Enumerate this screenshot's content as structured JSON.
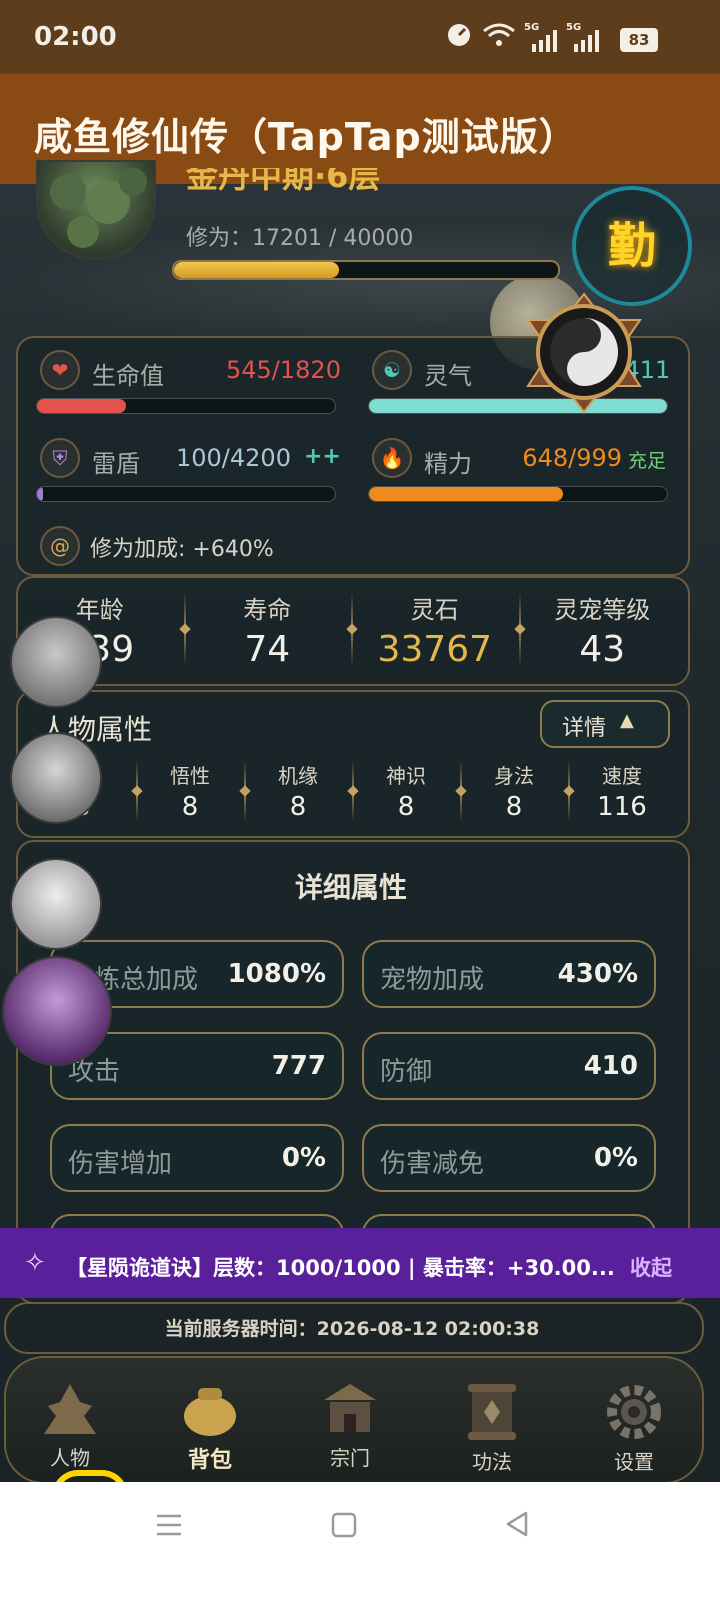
{
  "status_bar": {
    "time": "02:00",
    "battery": "83",
    "net1": "5G",
    "net2": "5G"
  },
  "app_title": "咸鱼修仙传（TapTap测试版）",
  "profile": {
    "realm": "金丹中期·6层",
    "cultivation_label": "修为：17201 / 40000",
    "cultivation_progress": 0.43,
    "badge": "勤"
  },
  "stats": {
    "hp": {
      "label": "生命值",
      "value": "545/1820",
      "fraction": 0.3
    },
    "qi": {
      "label": "灵气",
      "value": "6411/6411",
      "fraction": 1.0
    },
    "shield": {
      "label": "雷盾",
      "value": "100/4200",
      "extra": "++",
      "fraction": 0.02
    },
    "energy": {
      "label": "精力",
      "value": "648/999",
      "status": "充足",
      "fraction": 0.65
    },
    "bonus": "修为加成: +640%"
  },
  "info_row": [
    {
      "label": "年龄",
      "value": "239"
    },
    {
      "label": "寿命",
      "value": "74"
    },
    {
      "label": "灵石",
      "value": "33767"
    },
    {
      "label": "灵宠等级",
      "value": "43"
    }
  ],
  "attributes": {
    "title": "人物属性",
    "detail_button": "详情",
    "items": [
      {
        "label": "",
        "value": "8"
      },
      {
        "label": "悟性",
        "value": "8"
      },
      {
        "label": "机缘",
        "value": "8"
      },
      {
        "label": "神识",
        "value": "8"
      },
      {
        "label": "身法",
        "value": "8"
      },
      {
        "label": "速度",
        "value": "116"
      }
    ]
  },
  "detail": {
    "title": "详细属性",
    "cells": [
      {
        "label": "修炼总加成",
        "value": "1080%"
      },
      {
        "label": "宠物加成",
        "value": "430%"
      },
      {
        "label": "攻击",
        "value": "777"
      },
      {
        "label": "防御",
        "value": "410"
      },
      {
        "label": "伤害增加",
        "value": "0%"
      },
      {
        "label": "伤害减免",
        "value": "0%"
      }
    ]
  },
  "buff_banner": {
    "text": "【星陨诡道诀】层数：1000/1000 | 暴击率：+30.00...",
    "collapse": "收起"
  },
  "server_time": "当前服务器时间：2026-08-12 02:00:38",
  "nav": [
    {
      "label": "人物"
    },
    {
      "label": "背包"
    },
    {
      "label": "宗门"
    },
    {
      "label": "功法"
    },
    {
      "label": "设置"
    }
  ],
  "colors": {
    "accent": "#e6b84a",
    "hp": "#e4524a",
    "qi": "#52c8bd",
    "energy": "#f08a1c",
    "banner": "#5a1f9a"
  }
}
